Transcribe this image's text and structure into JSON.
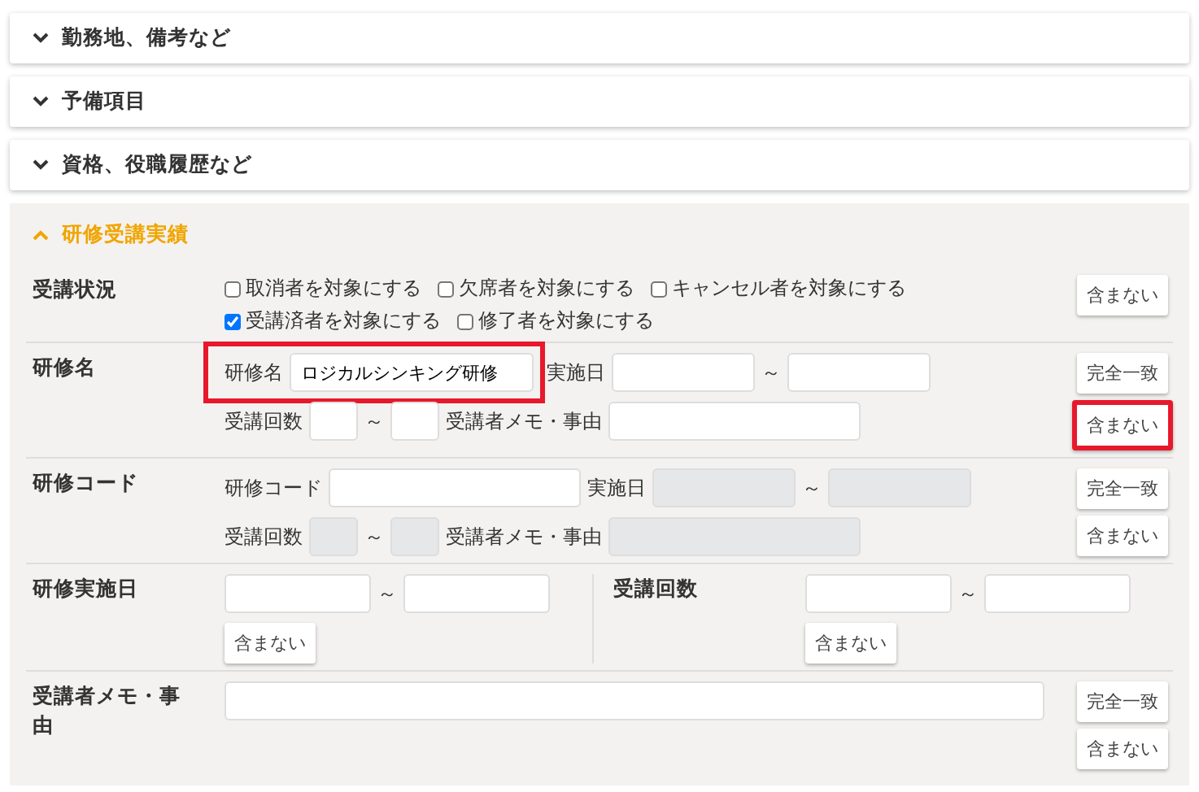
{
  "collapsed_sections": [
    {
      "title": "勤務地、備考など",
      "expanded": false
    },
    {
      "title": "予備項目",
      "expanded": false
    },
    {
      "title": "資格、役職履歴など",
      "expanded": false
    }
  ],
  "open_section": {
    "title": "研修受講実績",
    "expanded": true,
    "rows": [
      {
        "kind": "checks",
        "label": "受講状況",
        "lines": [
          [
            {
              "label": "取消者を対象にする",
              "checked": false
            },
            {
              "label": "欠席者を対象にする",
              "checked": false
            },
            {
              "label": "キャンセル者を対象にする",
              "checked": false
            }
          ],
          [
            {
              "label": "受講済者を対象にする",
              "checked": true
            },
            {
              "label": "修了者を対象にする",
              "checked": false
            }
          ]
        ],
        "buttons": [
          {
            "label": "含まない",
            "highlighted": false
          }
        ]
      },
      {
        "kind": "fields",
        "label": "研修名",
        "lines": [
          [
            {
              "kind": "name",
              "label": "研修名",
              "value": "ロジカルシンキング研修",
              "disabled": false,
              "highlighted": true
            },
            {
              "kind": "date",
              "label": "実施日",
              "disabled": false,
              "highlighted": false
            },
            {
              "kind": "tilde",
              "text": "～"
            },
            {
              "kind": "date",
              "disabled": false,
              "highlighted": false
            }
          ],
          [
            {
              "kind": "count",
              "label": "受講回数",
              "disabled": false,
              "highlighted": false
            },
            {
              "kind": "tilde",
              "text": "～"
            },
            {
              "kind": "count",
              "disabled": false,
              "highlighted": false
            },
            {
              "kind": "memo",
              "label": "受講者メモ・事由",
              "disabled": false,
              "highlighted": false
            }
          ]
        ],
        "buttons": [
          {
            "label": "完全一致",
            "highlighted": false
          },
          {
            "label": "含まない",
            "highlighted": true
          }
        ]
      },
      {
        "kind": "fields",
        "label": "研修コード",
        "lines": [
          [
            {
              "kind": "code",
              "label": "研修コード",
              "disabled": false,
              "highlighted": false
            },
            {
              "kind": "date",
              "label": "実施日",
              "disabled": true,
              "highlighted": false
            },
            {
              "kind": "tilde",
              "text": "～"
            },
            {
              "kind": "date",
              "disabled": true,
              "highlighted": false
            }
          ],
          [
            {
              "kind": "count",
              "label": "受講回数",
              "disabled": true,
              "highlighted": false
            },
            {
              "kind": "tilde",
              "text": "～"
            },
            {
              "kind": "count",
              "disabled": true,
              "highlighted": false
            },
            {
              "kind": "memo",
              "label": "受講者メモ・事由",
              "disabled": true,
              "highlighted": false
            }
          ]
        ],
        "buttons": [
          {
            "label": "完全一致",
            "highlighted": false
          },
          {
            "label": "含まない",
            "highlighted": false
          }
        ]
      },
      {
        "kind": "split",
        "cells": [
          {
            "label": "研修実施日",
            "tilde": "～",
            "button": {
              "label": "含まない",
              "highlighted": false
            }
          },
          {
            "label": "受講回数",
            "tilde": "～",
            "button": {
              "label": "含まない",
              "highlighted": false
            }
          }
        ]
      },
      {
        "kind": "wide",
        "label": "受講者メモ・事由",
        "buttons": [
          {
            "label": "完全一致",
            "highlighted": false
          },
          {
            "label": "含まない",
            "highlighted": false
          }
        ]
      }
    ]
  }
}
